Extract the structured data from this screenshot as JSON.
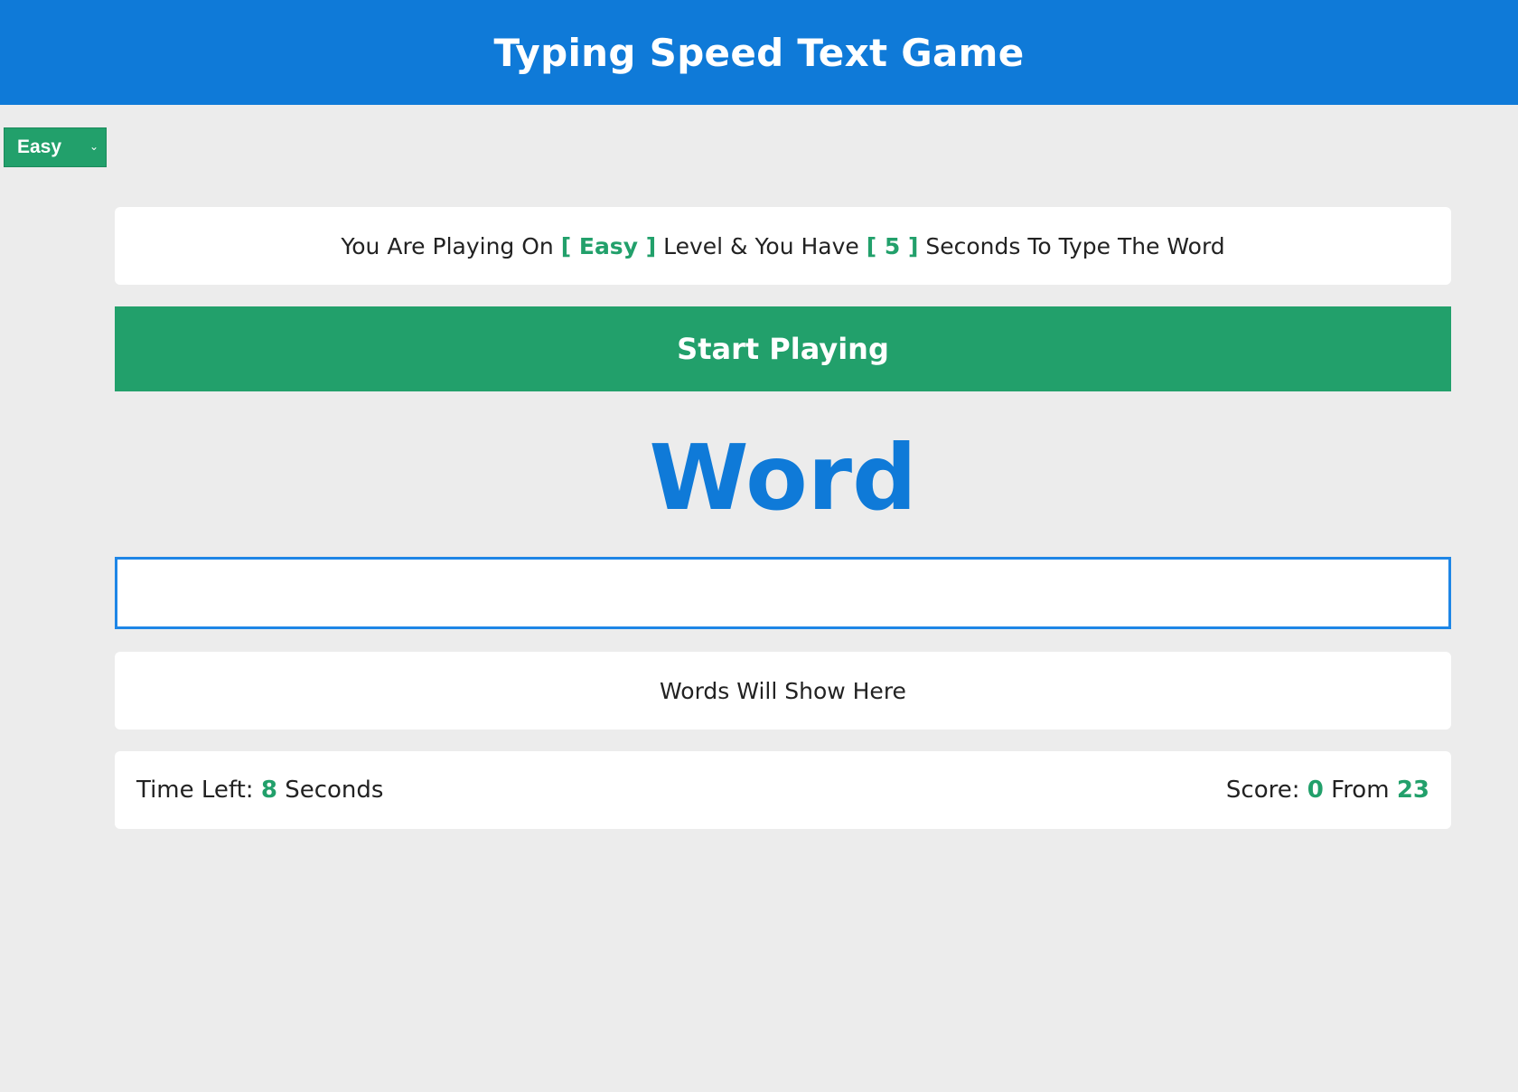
{
  "header": {
    "title": "Typing Speed Text Game"
  },
  "level_select": {
    "selected": "Easy",
    "chevron": "chevron-down-icon"
  },
  "message": {
    "part1": "You Are Playing On",
    "level": "[ Easy ]",
    "part2": "Level & You Have",
    "seconds": "[ 5 ]",
    "part3": "Seconds To Type The Word"
  },
  "start_button": {
    "label": "Start Playing"
  },
  "current_word": "Word",
  "input": {
    "value": "",
    "placeholder": ""
  },
  "upcoming_words": {
    "text": "Words Will Show Here"
  },
  "stats": {
    "time_label": "Time Left:",
    "time_value": "8",
    "time_unit": "Seconds",
    "score_label": "Score:",
    "score_value": "0",
    "from_label": "From",
    "total_value": "23"
  },
  "colors": {
    "header_blue": "#0f7ad8",
    "accent_green": "#22a06b",
    "background": "#ececec"
  }
}
